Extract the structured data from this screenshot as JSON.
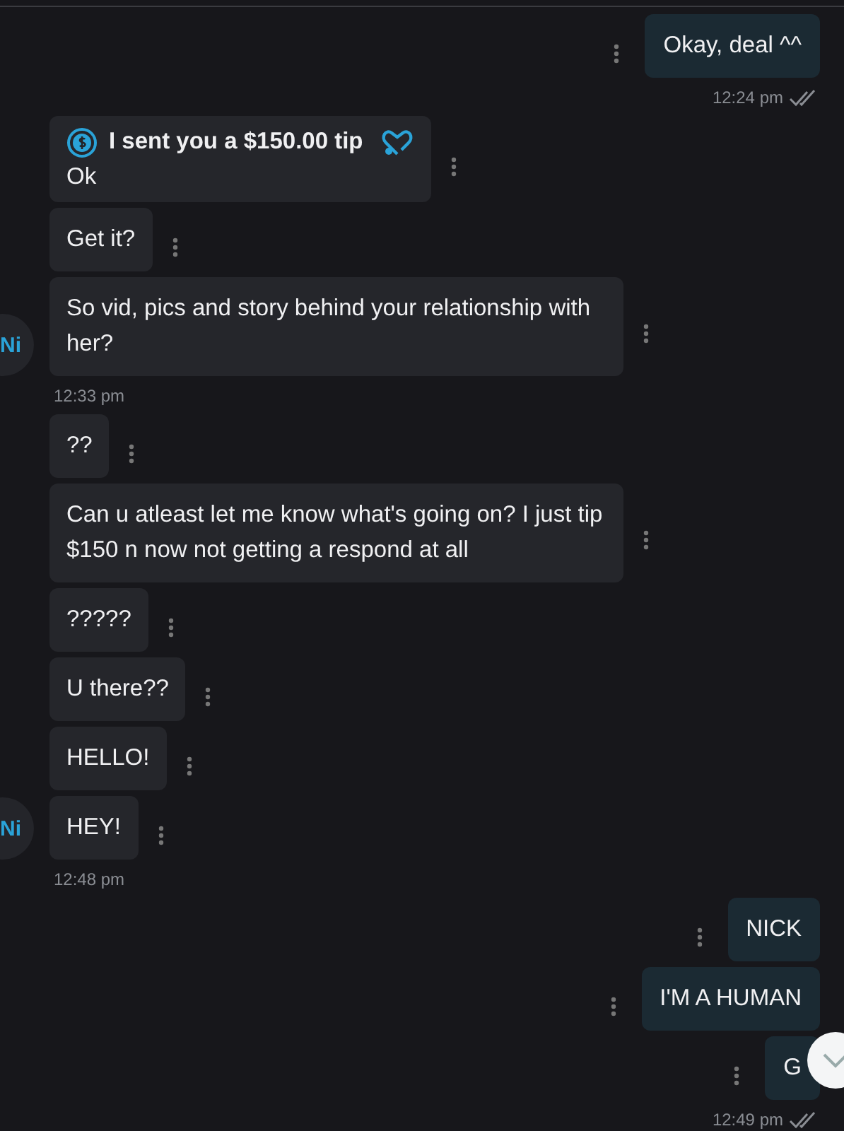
{
  "groups": [
    {
      "kind": "outgoing",
      "messages": [
        {
          "kind": "text",
          "text": "Okay, deal ^^"
        }
      ],
      "time": "12:24 pm",
      "read": true
    },
    {
      "kind": "incoming",
      "avatar": "Ni",
      "messages": [
        {
          "kind": "tip",
          "tip": "I sent you a $150.00 tip",
          "text": "Ok"
        },
        {
          "kind": "text",
          "text": "Get it?"
        },
        {
          "kind": "text",
          "text": "So vid, pics and story behind your relationship with her?"
        }
      ],
      "time": "12:33 pm"
    },
    {
      "kind": "incoming",
      "avatar": "Ni",
      "messages": [
        {
          "kind": "text",
          "text": "??"
        },
        {
          "kind": "text",
          "text": "Can u atleast let me know what's going on? I just tip $150 n now not getting a respond at all"
        },
        {
          "kind": "text",
          "text": "?????"
        },
        {
          "kind": "text",
          "text": "U there??"
        },
        {
          "kind": "text",
          "text": "HELLO!"
        },
        {
          "kind": "text",
          "text": "HEY!"
        }
      ],
      "time": "12:48 pm"
    },
    {
      "kind": "outgoing",
      "messages": [
        {
          "kind": "text",
          "text": "NICK"
        },
        {
          "kind": "text",
          "text": "I'M A HUMAN"
        },
        {
          "kind": "text",
          "text": "G"
        }
      ],
      "time": "12:49 pm",
      "read": true
    }
  ]
}
